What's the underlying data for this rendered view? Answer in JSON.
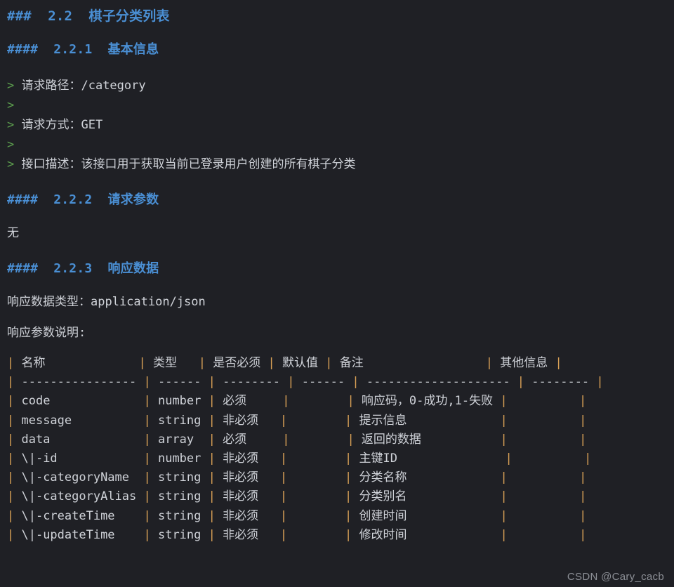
{
  "theme": {
    "background": "#1f2025",
    "text": "#cfd2d8",
    "heading": "#4a8fd4",
    "quote_marker": "#5c9e4e",
    "pipe": "#d8a056",
    "watermark": "#8d9097"
  },
  "document": {
    "section_heading": "###  2.2  棋子分类列表",
    "subsection_basic_info": "####  2.2.1  基本信息",
    "subsection_request_params": "####  2.2.2  请求参数",
    "subsection_response_data": "####  2.2.3  响应数据",
    "quotes": [
      {
        "marker": ">",
        "label": "请求路径：",
        "value": "/category"
      },
      {
        "marker": ">",
        "label": "",
        "value": ""
      },
      {
        "marker": ">",
        "label": "请求方式：",
        "value": "GET"
      },
      {
        "marker": ">",
        "label": "",
        "value": ""
      },
      {
        "marker": ">",
        "label": "接口描述：",
        "value": "该接口用于获取当前已登录用户创建的所有棋子分类"
      }
    ],
    "request_params_body": "无",
    "response_content_type": "响应数据类型：application/json",
    "response_params_caption": "响应参数说明:"
  },
  "table": {
    "headers": [
      "名称",
      "类型",
      "是否必须",
      "默认值",
      "备注",
      "其他信息"
    ],
    "separator": [
      "----------------",
      "------",
      "--------",
      "------",
      "--------------------",
      "--------"
    ],
    "rows": [
      {
        "name": "code",
        "type": "number",
        "required": "必须",
        "default": "",
        "remark": "响应码，0-成功,1-失败",
        "other": ""
      },
      {
        "name": "message",
        "type": "string",
        "required": "非必须",
        "default": "",
        "remark": "提示信息",
        "other": ""
      },
      {
        "name": "data",
        "type": "array",
        "required": "必须",
        "default": "",
        "remark": "返回的数据",
        "other": ""
      },
      {
        "name": "\\|-id",
        "type": "number",
        "required": "非必须",
        "default": "",
        "remark": "主键ID",
        "other": ""
      },
      {
        "name": "\\|-categoryName",
        "type": "string",
        "required": "非必须",
        "default": "",
        "remark": "分类名称",
        "other": ""
      },
      {
        "name": "\\|-categoryAlias",
        "type": "string",
        "required": "非必须",
        "default": "",
        "remark": "分类别名",
        "other": ""
      },
      {
        "name": "\\|-createTime",
        "type": "string",
        "required": "非必须",
        "default": "",
        "remark": "创建时间",
        "other": ""
      },
      {
        "name": "\\|-updateTime",
        "type": "string",
        "required": "非必须",
        "default": "",
        "remark": "修改时间",
        "other": ""
      }
    ]
  },
  "watermark": "CSDN @Cary_cacb"
}
